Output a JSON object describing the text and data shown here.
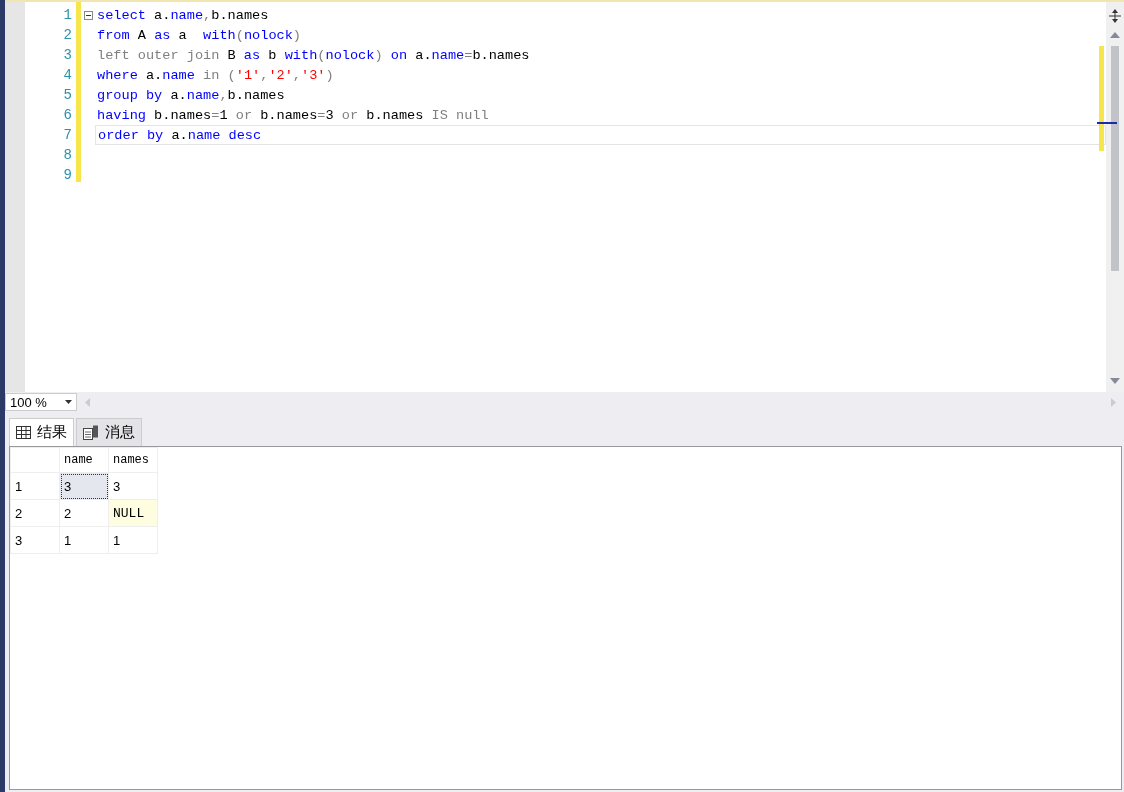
{
  "editor": {
    "lines": [
      {
        "number": "1",
        "current": false,
        "tokens": [
          {
            "kind": "kw",
            "text": "select"
          },
          {
            "kind": "plain",
            "text": " a."
          },
          {
            "kind": "kw",
            "text": "name"
          },
          {
            "kind": "grey",
            "text": ","
          },
          {
            "kind": "plain",
            "text": "b.names"
          }
        ]
      },
      {
        "number": "2",
        "current": false,
        "tokens": [
          {
            "kind": "kw",
            "text": "from"
          },
          {
            "kind": "plain",
            "text": " A "
          },
          {
            "kind": "kw",
            "text": "as"
          },
          {
            "kind": "plain",
            "text": " a  "
          },
          {
            "kind": "kw",
            "text": "with"
          },
          {
            "kind": "grey",
            "text": "("
          },
          {
            "kind": "kw",
            "text": "nolock"
          },
          {
            "kind": "grey",
            "text": ")"
          }
        ]
      },
      {
        "number": "3",
        "current": false,
        "tokens": [
          {
            "kind": "grey",
            "text": "left outer join"
          },
          {
            "kind": "plain",
            "text": " B "
          },
          {
            "kind": "kw",
            "text": "as"
          },
          {
            "kind": "plain",
            "text": " b "
          },
          {
            "kind": "kw",
            "text": "with"
          },
          {
            "kind": "grey",
            "text": "("
          },
          {
            "kind": "kw",
            "text": "nolock"
          },
          {
            "kind": "grey",
            "text": ")"
          },
          {
            "kind": "kw",
            "text": " on"
          },
          {
            "kind": "plain",
            "text": " a."
          },
          {
            "kind": "kw",
            "text": "name"
          },
          {
            "kind": "grey",
            "text": "="
          },
          {
            "kind": "plain",
            "text": "b.names"
          }
        ]
      },
      {
        "number": "4",
        "current": false,
        "tokens": [
          {
            "kind": "kw",
            "text": "where"
          },
          {
            "kind": "plain",
            "text": " a."
          },
          {
            "kind": "kw",
            "text": "name"
          },
          {
            "kind": "grey",
            "text": " in ("
          },
          {
            "kind": "str",
            "text": "'1'"
          },
          {
            "kind": "grey",
            "text": ","
          },
          {
            "kind": "str",
            "text": "'2'"
          },
          {
            "kind": "grey",
            "text": ","
          },
          {
            "kind": "str",
            "text": "'3'"
          },
          {
            "kind": "grey",
            "text": ")"
          }
        ]
      },
      {
        "number": "5",
        "current": false,
        "tokens": [
          {
            "kind": "kw",
            "text": "group by"
          },
          {
            "kind": "plain",
            "text": " a."
          },
          {
            "kind": "kw",
            "text": "name"
          },
          {
            "kind": "grey",
            "text": ","
          },
          {
            "kind": "plain",
            "text": "b.names"
          }
        ]
      },
      {
        "number": "6",
        "current": false,
        "tokens": [
          {
            "kind": "kw",
            "text": "having"
          },
          {
            "kind": "plain",
            "text": " b.names"
          },
          {
            "kind": "grey",
            "text": "="
          },
          {
            "kind": "plain",
            "text": "1 "
          },
          {
            "kind": "grey",
            "text": "or"
          },
          {
            "kind": "plain",
            "text": " b.names"
          },
          {
            "kind": "grey",
            "text": "="
          },
          {
            "kind": "plain",
            "text": "3 "
          },
          {
            "kind": "grey",
            "text": "or"
          },
          {
            "kind": "plain",
            "text": " b.names "
          },
          {
            "kind": "grey",
            "text": "IS null"
          }
        ]
      },
      {
        "number": "7",
        "current": true,
        "tokens": [
          {
            "kind": "kw",
            "text": "order by"
          },
          {
            "kind": "plain",
            "text": " a."
          },
          {
            "kind": "kw",
            "text": "name"
          },
          {
            "kind": "kw",
            "text": " desc"
          }
        ]
      },
      {
        "number": "8",
        "current": false
      },
      {
        "number": "9",
        "current": false
      }
    ]
  },
  "zoom": {
    "value": "100 %"
  },
  "tabs": [
    {
      "label": "结果",
      "selected": true
    },
    {
      "label": "消息",
      "selected": false
    }
  ],
  "grid": {
    "columns": [
      "name",
      "names"
    ],
    "rows": [
      {
        "number": "1",
        "cells": [
          {
            "text": "3",
            "selected": true,
            "null": false
          },
          {
            "text": "3",
            "selected": false,
            "null": false
          }
        ]
      },
      {
        "number": "2",
        "cells": [
          {
            "text": "2",
            "selected": false,
            "null": false
          },
          {
            "text": "NULL",
            "selected": false,
            "null": true
          }
        ]
      },
      {
        "number": "3",
        "cells": [
          {
            "text": "1",
            "selected": false,
            "null": false
          },
          {
            "text": "1",
            "selected": false,
            "null": false
          }
        ]
      }
    ]
  }
}
